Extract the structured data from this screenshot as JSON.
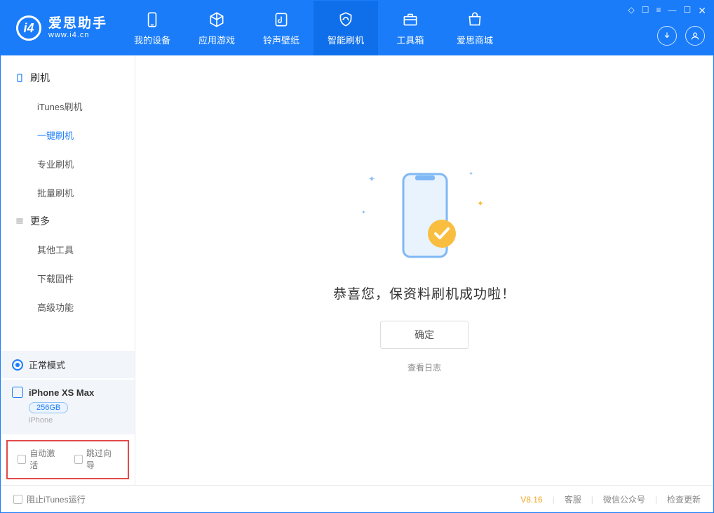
{
  "app": {
    "name_cn": "爱思助手",
    "url": "www.i4.cn"
  },
  "nav": {
    "my_device": "我的设备",
    "apps_games": "应用游戏",
    "ringtones": "铃声壁纸",
    "smart_flash": "智能刷机",
    "toolbox": "工具箱",
    "store": "爱思商城"
  },
  "sidebar": {
    "group_flash": "刷机",
    "itunes_flash": "iTunes刷机",
    "one_key_flash": "一键刷机",
    "pro_flash": "专业刷机",
    "batch_flash": "批量刷机",
    "group_more": "更多",
    "other_tools": "其他工具",
    "download_fw": "下载固件",
    "advanced": "高级功能"
  },
  "status": {
    "mode": "正常模式"
  },
  "device": {
    "name": "iPhone XS Max",
    "capacity": "256GB",
    "type": "iPhone"
  },
  "checks": {
    "auto_activate": "自动激活",
    "skip_guide": "跳过向导"
  },
  "result": {
    "title": "恭喜您，保资料刷机成功啦！",
    "ok": "确定",
    "view_log": "查看日志"
  },
  "footer": {
    "block_itunes": "阻止iTunes运行",
    "version": "V8.16",
    "support": "客服",
    "wechat": "微信公众号",
    "check_update": "检查更新"
  }
}
